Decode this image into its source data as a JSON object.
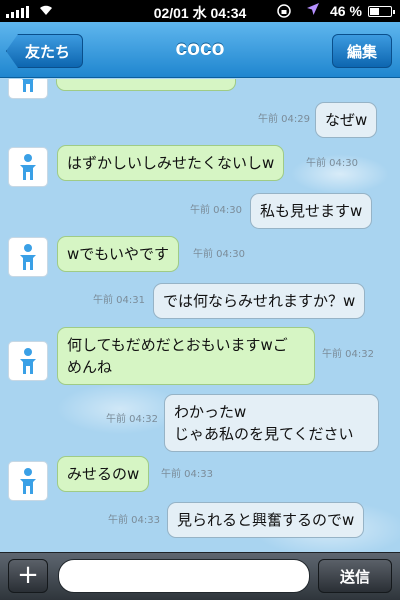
{
  "status_bar": {
    "time": "02/01 水 04:34",
    "battery_percent": "46 %",
    "battery_level": 0.46
  },
  "nav": {
    "back_label": "友たち",
    "title": "coco",
    "edit_label": "編集"
  },
  "messages": [
    {
      "dir": "in",
      "text": "",
      "time": ""
    },
    {
      "dir": "out",
      "text": "なぜw",
      "time": "午前 04:29"
    },
    {
      "dir": "in",
      "text": "はずかしいしみせたくないしw",
      "time": "午前 04:30"
    },
    {
      "dir": "out",
      "text": "私も見せますw",
      "time": "午前 04:30"
    },
    {
      "dir": "in",
      "text": "wでもいやです",
      "time": "午前 04:30"
    },
    {
      "dir": "out",
      "text": "では何ならみせれますか？w",
      "time": "午前 04:31"
    },
    {
      "dir": "in",
      "text": "何してもだめだとおもいますwご\nめんね",
      "time": "午前 04:32"
    },
    {
      "dir": "out",
      "text": "わかったw\nじゃあ私のを見てください",
      "time": "午前 04:32"
    },
    {
      "dir": "in",
      "text": "みせるのw",
      "time": "午前 04:33"
    },
    {
      "dir": "out",
      "text": "見られると興奮するのでw",
      "time": "午前 04:33"
    }
  ],
  "input_bar": {
    "plus_label": "+",
    "placeholder": "",
    "send_label": "送信"
  },
  "icons": {
    "avatar": "person-icon",
    "back": "back-arrow-button",
    "location": "location-arrow-icon",
    "lock": "rotation-lock-icon",
    "wifi": "wifi-icon",
    "signal": "signal-bars-icon"
  }
}
